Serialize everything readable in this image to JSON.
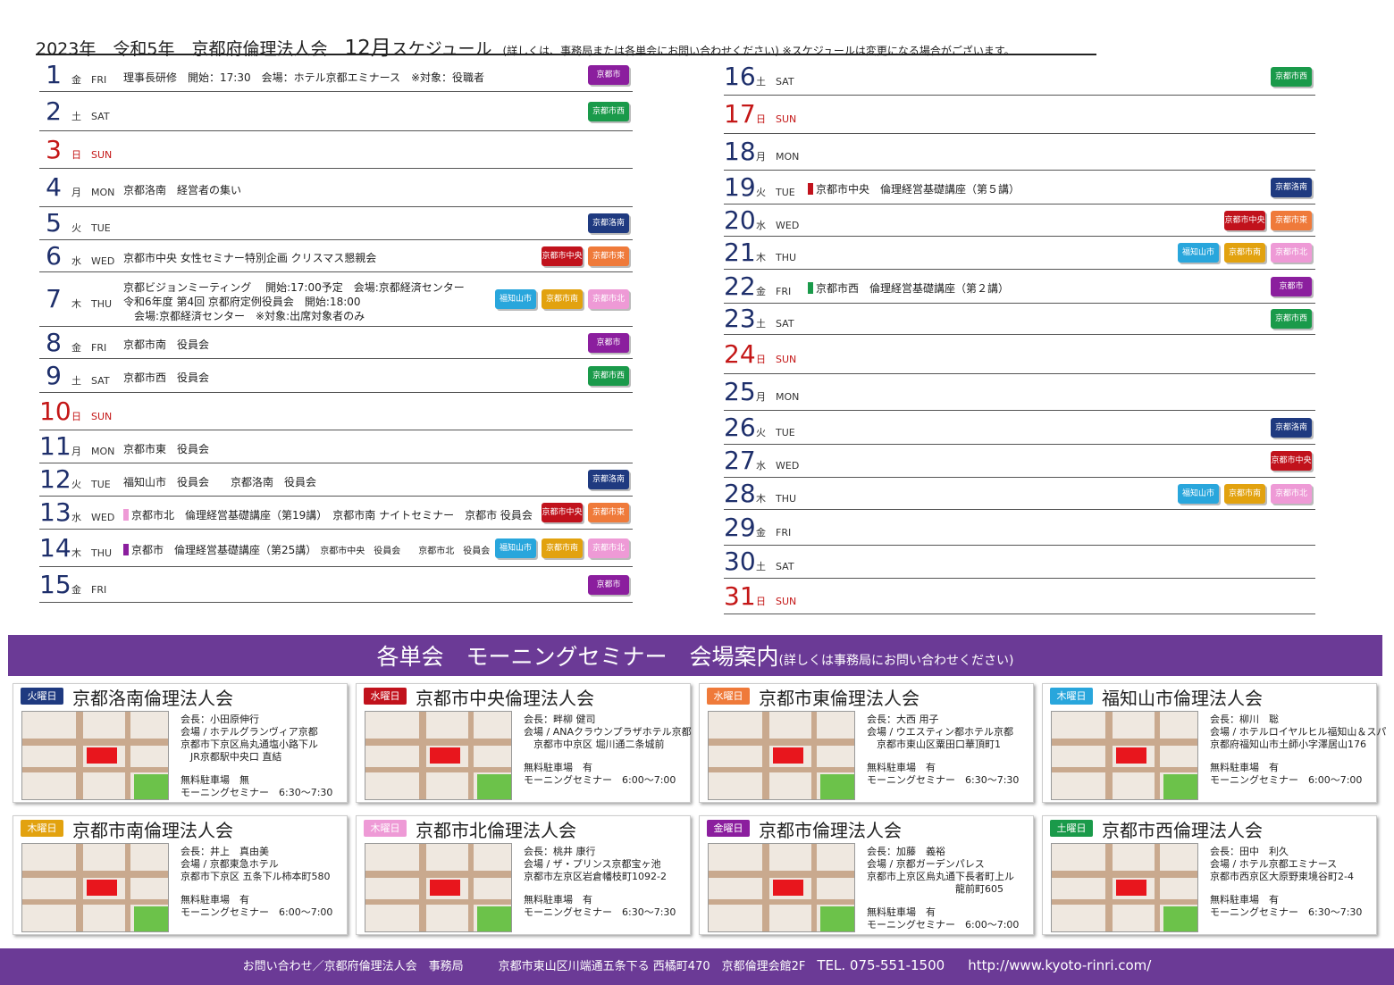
{
  "header": {
    "year": "2023年",
    "era": "令和5年",
    "org": "京都府倫理法人会",
    "month": "12月",
    "schedule": "スケジュール",
    "note": "(詳しくは、事務局または各単会にお問い合わせください) ※スケジュールは変更になる場合がございます。"
  },
  "colors": {
    "purple": "#6b3a96",
    "rakunan": "#1f3a80",
    "chuo": "#c1121c",
    "higashi": "#ef7a3a",
    "nishi": "#1a9a4a",
    "fukuchiyama": "#29a6dc",
    "minami": "#e2a20f",
    "kita": "#ee9ad6",
    "kyoto": "#8b1e9e"
  },
  "days_left": [
    {
      "n": "1",
      "jp": "金",
      "en": "FRI",
      "sun": false,
      "lines": [
        "理事長研修　開始：17:30　会場：ホテル京都エミナース　※対象：役職者"
      ],
      "badges": [
        {
          "t": "京都市",
          "c": "#8b1e9e"
        }
      ]
    },
    {
      "n": "2",
      "jp": "土",
      "en": "SAT",
      "sun": false,
      "lines": [
        ""
      ],
      "badges": [
        {
          "t": "京都市西",
          "c": "#1a9a4a"
        }
      ]
    },
    {
      "n": "3",
      "jp": "日",
      "en": "SUN",
      "sun": true,
      "lines": [
        ""
      ],
      "badges": []
    },
    {
      "n": "4",
      "jp": "月",
      "en": "MON",
      "sun": false,
      "lines": [
        "京都洛南　経営者の集い"
      ],
      "badges": []
    },
    {
      "n": "5",
      "jp": "火",
      "en": "TUE",
      "sun": false,
      "lines": [
        ""
      ],
      "badges": [
        {
          "t": "京都洛南",
          "c": "#1f3a80"
        }
      ]
    },
    {
      "n": "6",
      "jp": "水",
      "en": "WED",
      "sun": false,
      "lines": [
        "京都市中央 女性セミナー特別企画 クリスマス懇親会"
      ],
      "badges": [
        {
          "t": "京都市中央",
          "c": "#c1121c"
        },
        {
          "t": "京都市東",
          "c": "#ef7a3a"
        }
      ]
    },
    {
      "n": "7",
      "jp": "木",
      "en": "THU",
      "sun": false,
      "lines": [
        "京都ビジョンミーティング　 開始:17:00予定　会場:京都経済センター",
        "令和6年度 第4回 京都府定例役員会　開始:18:00",
        "　会場:京都経済センター　※対象:出席対象者のみ"
      ],
      "badges": [
        {
          "t": "福知山市",
          "c": "#29a6dc"
        },
        {
          "t": "京都市南",
          "c": "#e2a20f"
        },
        {
          "t": "京都市北",
          "c": "#ee9ad6"
        }
      ]
    },
    {
      "n": "8",
      "jp": "金",
      "en": "FRI",
      "sun": false,
      "lines": [
        "京都市南　役員会"
      ],
      "badges": [
        {
          "t": "京都市",
          "c": "#8b1e9e"
        }
      ]
    },
    {
      "n": "9",
      "jp": "土",
      "en": "SAT",
      "sun": false,
      "lines": [
        "京都市西　役員会"
      ],
      "badges": [
        {
          "t": "京都市西",
          "c": "#1a9a4a"
        }
      ]
    },
    {
      "n": "10",
      "jp": "日",
      "en": "SUN",
      "sun": true,
      "lines": [
        ""
      ],
      "badges": []
    },
    {
      "n": "11",
      "jp": "月",
      "en": "MON",
      "sun": false,
      "lines": [
        "京都市東　役員会"
      ],
      "badges": []
    },
    {
      "n": "12",
      "jp": "火",
      "en": "TUE",
      "sun": false,
      "lines": [
        "福知山市　役員会　　京都洛南　役員会"
      ],
      "badges": [
        {
          "t": "京都洛南",
          "c": "#1f3a80"
        }
      ]
    },
    {
      "n": "13",
      "jp": "水",
      "en": "WED",
      "sun": false,
      "mark": "#ee9ad6",
      "lines": [
        "京都市北　倫理経営基礎講座（第19講）　京都市南 ナイトセミナー　京都市 役員会"
      ],
      "badges": [
        {
          "t": "京都市中央",
          "c": "#c1121c"
        },
        {
          "t": "京都市東",
          "c": "#ef7a3a"
        }
      ]
    },
    {
      "n": "14",
      "jp": "木",
      "en": "THU",
      "sun": false,
      "mark": "#8b1e9e",
      "lines": [
        "京都市　倫理経営基礎講座（第25講）"
      ],
      "small": "京都市中央　役員会　　京都市北　役員会",
      "badges": [
        {
          "t": "福知山市",
          "c": "#29a6dc"
        },
        {
          "t": "京都市南",
          "c": "#e2a20f"
        },
        {
          "t": "京都市北",
          "c": "#ee9ad6"
        }
      ]
    },
    {
      "n": "15",
      "jp": "金",
      "en": "FRI",
      "sun": false,
      "lines": [
        ""
      ],
      "badges": [
        {
          "t": "京都市",
          "c": "#8b1e9e"
        }
      ]
    }
  ],
  "days_right": [
    {
      "n": "16",
      "jp": "土",
      "en": "SAT",
      "sun": false,
      "lines": [
        ""
      ],
      "badges": [
        {
          "t": "京都市西",
          "c": "#1a9a4a"
        }
      ]
    },
    {
      "n": "17",
      "jp": "日",
      "en": "SUN",
      "sun": true,
      "lines": [
        ""
      ],
      "badges": []
    },
    {
      "n": "18",
      "jp": "月",
      "en": "MON",
      "sun": false,
      "lines": [
        ""
      ],
      "badges": []
    },
    {
      "n": "19",
      "jp": "火",
      "en": "TUE",
      "sun": false,
      "mark": "#c1121c",
      "lines": [
        "京都市中央　倫理経営基礎講座（第５講）"
      ],
      "badges": [
        {
          "t": "京都洛南",
          "c": "#1f3a80"
        }
      ]
    },
    {
      "n": "20",
      "jp": "水",
      "en": "WED",
      "sun": false,
      "lines": [
        ""
      ],
      "badges": [
        {
          "t": "京都市中央",
          "c": "#c1121c"
        },
        {
          "t": "京都市東",
          "c": "#ef7a3a"
        }
      ]
    },
    {
      "n": "21",
      "jp": "木",
      "en": "THU",
      "sun": false,
      "lines": [
        ""
      ],
      "badges": [
        {
          "t": "福知山市",
          "c": "#29a6dc"
        },
        {
          "t": "京都市南",
          "c": "#e2a20f"
        },
        {
          "t": "京都市北",
          "c": "#ee9ad6"
        }
      ]
    },
    {
      "n": "22",
      "jp": "金",
      "en": "FRI",
      "sun": false,
      "mark": "#1a9a4a",
      "lines": [
        "京都市西　倫理経営基礎講座（第２講）"
      ],
      "badges": [
        {
          "t": "京都市",
          "c": "#8b1e9e"
        }
      ]
    },
    {
      "n": "23",
      "jp": "土",
      "en": "SAT",
      "sun": false,
      "lines": [
        ""
      ],
      "badges": [
        {
          "t": "京都市西",
          "c": "#1a9a4a"
        }
      ]
    },
    {
      "n": "24",
      "jp": "日",
      "en": "SUN",
      "sun": true,
      "lines": [
        ""
      ],
      "badges": []
    },
    {
      "n": "25",
      "jp": "月",
      "en": "MON",
      "sun": false,
      "lines": [
        ""
      ],
      "badges": []
    },
    {
      "n": "26",
      "jp": "火",
      "en": "TUE",
      "sun": false,
      "lines": [
        ""
      ],
      "badges": [
        {
          "t": "京都洛南",
          "c": "#1f3a80"
        }
      ]
    },
    {
      "n": "27",
      "jp": "水",
      "en": "WED",
      "sun": false,
      "lines": [
        ""
      ],
      "badges": [
        {
          "t": "京都市中央",
          "c": "#c1121c"
        }
      ]
    },
    {
      "n": "28",
      "jp": "木",
      "en": "THU",
      "sun": false,
      "lines": [
        ""
      ],
      "badges": [
        {
          "t": "福知山市",
          "c": "#29a6dc"
        },
        {
          "t": "京都市南",
          "c": "#e2a20f"
        },
        {
          "t": "京都市北",
          "c": "#ee9ad6"
        }
      ]
    },
    {
      "n": "29",
      "jp": "金",
      "en": "FRI",
      "sun": false,
      "lines": [
        ""
      ],
      "badges": []
    },
    {
      "n": "30",
      "jp": "土",
      "en": "SAT",
      "sun": false,
      "lines": [
        ""
      ],
      "badges": []
    },
    {
      "n": "31",
      "jp": "日",
      "en": "SUN",
      "sun": true,
      "lines": [
        ""
      ],
      "badges": []
    }
  ],
  "seminar": {
    "title": "各単会　モーニングセミナー　会場案内",
    "sub": "(詳しくは事務局にお問い合わせください)"
  },
  "cards": [
    {
      "day": "火曜日",
      "color": "#1f3a80",
      "name": "京都洛南倫理法人会",
      "info": [
        "会長：小田原伸行",
        "会場 / ホテルグランヴィア京都",
        "京都市下京区烏丸通塩小路下ル",
        "　JR京都駅中央口 直結"
      ],
      "parking": "無料駐車場　無",
      "time": "モーニングセミナー　6:30～7:30"
    },
    {
      "day": "水曜日",
      "color": "#c1121c",
      "name": "京都市中央倫理法人会",
      "info": [
        "会長：畔柳 健司",
        "会場 / ANAクラウンプラザホテル京都",
        "　京都市中京区 堀川通二条城前"
      ],
      "parking": "無料駐車場　有",
      "time": "モーニングセミナー　6:00～7:00"
    },
    {
      "day": "水曜日",
      "color": "#ef7a3a",
      "name": "京都市東倫理法人会",
      "info": [
        "会長：大西 用子",
        "会場 / ウエスティン都ホテル京都",
        "　京都市東山区粟田口華頂町1"
      ],
      "parking": "無料駐車場　有",
      "time": "モーニングセミナー　6:30～7:30"
    },
    {
      "day": "木曜日",
      "color": "#29a6dc",
      "name": "福知山市倫理法人会",
      "info": [
        "会長：柳川　聡",
        "会場 / ホテルロイヤルヒル福知山＆スパ",
        "京都府福知山市土師小字澤居山176"
      ],
      "parking": "無料駐車場　有",
      "time": "モーニングセミナー　6:00～7:00"
    },
    {
      "day": "木曜日",
      "color": "#e2a20f",
      "name": "京都市南倫理法人会",
      "info": [
        "会長：井上　真由美",
        "会場 / 京都東急ホテル",
        "京都市下京区 五条下ル柿本町580"
      ],
      "parking": "無料駐車場　有",
      "time": "モーニングセミナー　6:00～7:00"
    },
    {
      "day": "木曜日",
      "color": "#ee9ad6",
      "name": "京都市北倫理法人会",
      "info": [
        "会長：桃井 康行",
        "会場 / ザ・プリンス京都宝ヶ池",
        "京都市左京区岩倉幡枝町1092-2"
      ],
      "parking": "無料駐車場　有",
      "time": "モーニングセミナー　6:30～7:30"
    },
    {
      "day": "金曜日",
      "color": "#8b1e9e",
      "name": "京都市倫理法人会",
      "info": [
        "会長：加藤　義裕",
        "会場 / 京都ガーデンパレス",
        "京都市上京区烏丸通下長者町上ル",
        "　　　　　　　　　龍前町605"
      ],
      "parking": "無料駐車場　有",
      "time": "モーニングセミナー　6:00～7:00"
    },
    {
      "day": "土曜日",
      "color": "#1a9a4a",
      "name": "京都市西倫理法人会",
      "info": [
        "会長：田中　利久",
        "会場 / ホテル京都エミナース",
        "京都市西京区大原野東境谷町2-4"
      ],
      "parking": "無料駐車場　有",
      "time": "モーニングセミナー　6:30～7:30"
    }
  ],
  "footer": {
    "contact": "お問い合わせ／京都府倫理法人会　事務局",
    "address": "京都市東山区川端通五条下る 西橘町470　京都倫理会館2F",
    "tel": "TEL. 075-551-1500",
    "url": "http://www.kyoto-rinri.com/"
  }
}
